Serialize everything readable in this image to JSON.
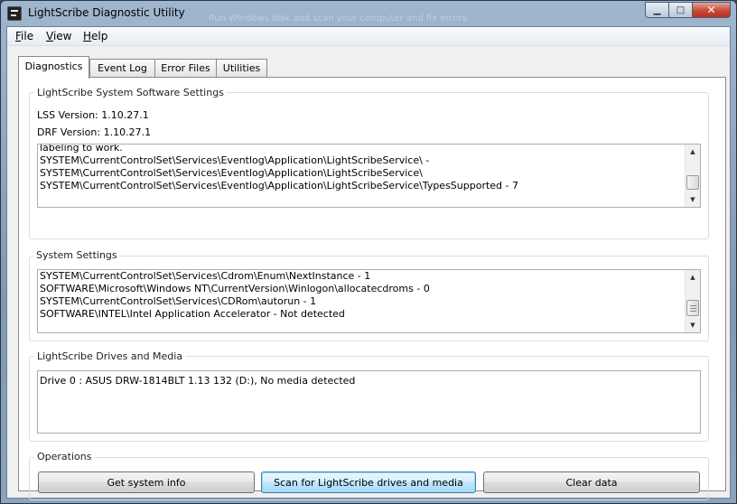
{
  "window": {
    "title": "LightScribe Diagnostic Utility",
    "faint_background_text": "Run Windows disk and scan your computer and fix errors",
    "controls": {
      "minimize": "▁",
      "maximize": "□",
      "close": "✕"
    }
  },
  "menu": {
    "file": {
      "mnemonic": "F",
      "rest": "ile"
    },
    "view": {
      "mnemonic": "V",
      "rest": "iew"
    },
    "help": {
      "mnemonic": "H",
      "rest": "elp"
    }
  },
  "tabs": [
    {
      "label": "Diagnostics",
      "active": true
    },
    {
      "label": "Event Log",
      "active": false
    },
    {
      "label": "Error Files",
      "active": false
    },
    {
      "label": "Utilities",
      "active": false
    }
  ],
  "software_settings": {
    "title": "LightScribe System Software Settings",
    "lss_version": "LSS Version: 1.10.27.1",
    "drf_version": "DRF Version: 1.10.27.1",
    "lines": [
      "labeling to work.",
      "SYSTEM\\CurrentControlSet\\Services\\Eventlog\\Application\\LightScribeService\\ -",
      "SYSTEM\\CurrentControlSet\\Services\\Eventlog\\Application\\LightScribeService\\",
      "SYSTEM\\CurrentControlSet\\Services\\Eventlog\\Application\\LightScribeService\\TypesSupported - 7"
    ]
  },
  "system_settings": {
    "title": "System Settings",
    "lines": [
      "SYSTEM\\CurrentControlSet\\Services\\Cdrom\\Enum\\NextInstance - 1",
      "SOFTWARE\\Microsoft\\Windows NT\\CurrentVersion\\Winlogon\\allocatecdroms - 0",
      "SYSTEM\\CurrentControlSet\\Services\\CDRom\\autorun - 1",
      "SOFTWARE\\INTEL\\Intel Application Accelerator - Not detected"
    ]
  },
  "drives": {
    "title": "LightScribe Drives and Media",
    "lines": [
      "Drive 0 : ASUS DRW-1814BLT 1.13 132 (D:), No media detected"
    ]
  },
  "operations": {
    "title": "Operations",
    "get_info": "Get system info",
    "scan": "Scan for LightScribe drives and media",
    "clear": "Clear data"
  },
  "colors": {
    "focus_button_border": "#3c7fb1",
    "group_border": "#d5dfe5",
    "close_button": "#c8483a"
  }
}
